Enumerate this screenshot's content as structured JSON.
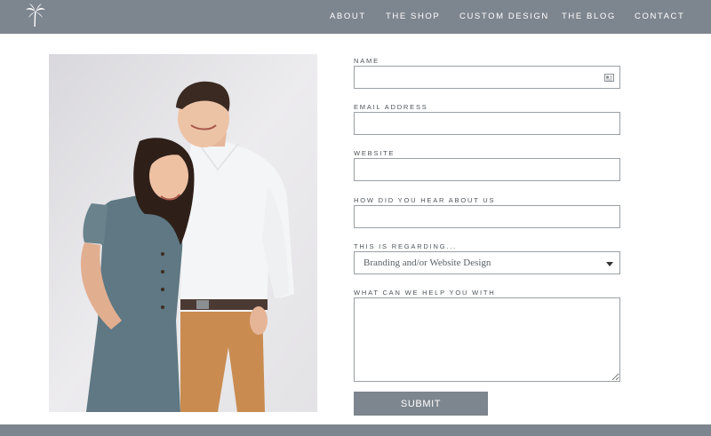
{
  "nav": {
    "items": [
      {
        "label": "ABOUT"
      },
      {
        "label": "THE SHOP"
      },
      {
        "label": "CUSTOM DESIGN"
      },
      {
        "label": "THE BLOG"
      },
      {
        "label": "CONTACT"
      }
    ]
  },
  "form": {
    "name_label": "NAME",
    "name_value": "",
    "email_label": "EMAIL ADDRESS",
    "email_value": "",
    "website_label": "WEBSITE",
    "website_value": "",
    "hear_label": "HOW DID YOU HEAR ABOUT US",
    "hear_value": "",
    "regarding_label": "THIS IS REGARDING...",
    "regarding_selected": "Branding and/or Website Design",
    "help_label": "WHAT CAN WE HELP YOU WITH",
    "help_value": "",
    "submit_label": "SUBMIT"
  },
  "icons": {
    "logo": "palm-tree-icon",
    "name_field": "contact-card-icon",
    "select": "chevron-down-icon"
  },
  "colors": {
    "header_bg": "#7d858e",
    "button_bg": "#7d858e",
    "field_border": "#9aa0a6"
  }
}
